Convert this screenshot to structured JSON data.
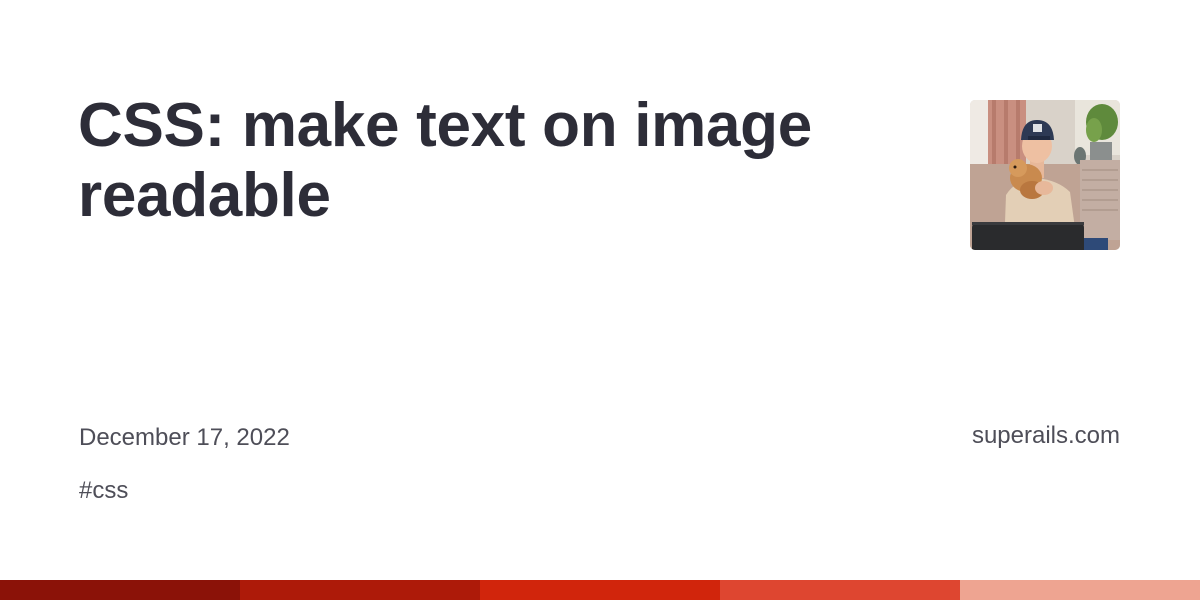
{
  "post": {
    "title": "CSS: make text on image readable",
    "date": "December 17, 2022",
    "tag": "#css"
  },
  "site": {
    "domain": "superails.com"
  },
  "avatar": {
    "icon": "author-photo"
  },
  "theme": {
    "title_color": "#2d2d38",
    "meta_color": "#4e4e58",
    "stripe_colors": [
      "#8b1208",
      "#ad1a09",
      "#d1250c",
      "#de4630",
      "#eea491"
    ]
  }
}
